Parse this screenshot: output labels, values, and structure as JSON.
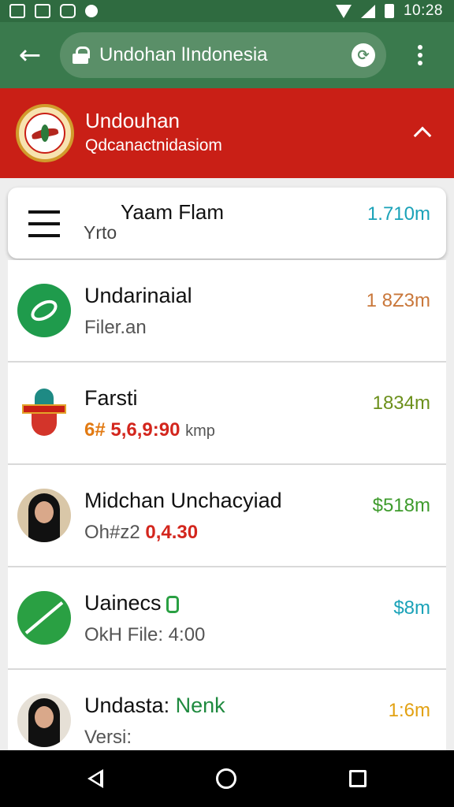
{
  "status_bar": {
    "time": "10:28",
    "icons": [
      "image-icon",
      "sim-icon",
      "message-icon",
      "circle-icon",
      "wifi-icon",
      "signal-icon",
      "battery-icon"
    ]
  },
  "toolbar": {
    "url": "Undohan lIndonesia",
    "icons": [
      "back-arrow-icon",
      "lock-icon",
      "share-icon",
      "more-vert-icon"
    ]
  },
  "header": {
    "title": "Undouhan",
    "subtitle": "Qdcanactnidasiom",
    "accent_color": "#c91f16"
  },
  "top_card": {
    "title": "Yaam Flam",
    "subtitle": "Yrto",
    "meta": "1.710m"
  },
  "items": [
    {
      "title": "Undarinaial",
      "subtitle": "Filer.an",
      "meta": "1 8Z3m",
      "meta_color": "#c9773a",
      "avatar": "green-swirl"
    },
    {
      "title": "Farsti",
      "subtitle_prefix": "6#",
      "subtitle_highlight": "5,6,9:90",
      "subtitle_suffix": "kmp",
      "meta": "1834m",
      "meta_color": "#6b8f1a",
      "avatar": "badge"
    },
    {
      "title": "Midchan Unchacyiad",
      "subtitle_prefix": "Oh#z2",
      "subtitle_highlight": "0,4.30",
      "meta": "$518m",
      "meta_color": "#3e9b2c",
      "avatar": "person"
    },
    {
      "title": "Uainecs",
      "subtitle": "OkH File: 4:00",
      "meta": "$8m",
      "meta_color": "#1aa2b8",
      "avatar": "crossed"
    },
    {
      "title_prefix": "Undasta:",
      "title_highlight": "Nenk",
      "subtitle": "Versi:",
      "meta": "1:6m",
      "meta_color": "#e2a112",
      "avatar": "person2"
    }
  ],
  "nav": {
    "icons": [
      "nav-back-icon",
      "nav-home-icon",
      "nav-recents-icon"
    ]
  }
}
